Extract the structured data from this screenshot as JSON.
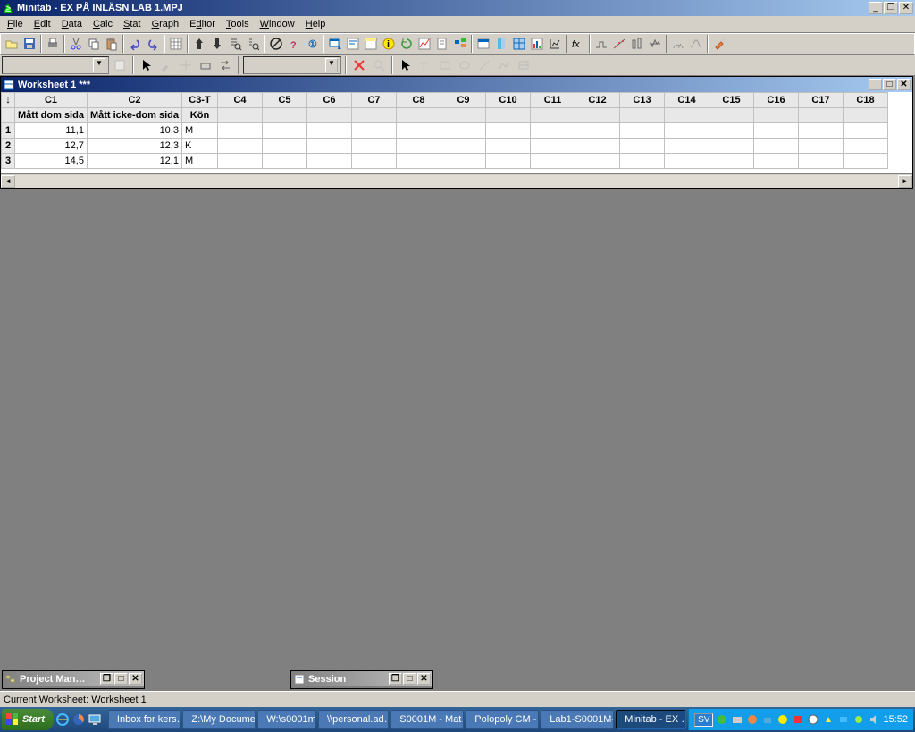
{
  "titlebar": {
    "title": "Minitab - EX PÅ INLÄSN LAB 1.MPJ"
  },
  "menubar": {
    "items": [
      "File",
      "Edit",
      "Data",
      "Calc",
      "Stat",
      "Graph",
      "Editor",
      "Tools",
      "Window",
      "Help"
    ]
  },
  "worksheet": {
    "title": "Worksheet 1 ***",
    "columns": [
      "C1",
      "C2",
      "C3-T",
      "C4",
      "C5",
      "C6",
      "C7",
      "C8",
      "C9",
      "C10",
      "C11",
      "C12",
      "C13",
      "C14",
      "C15",
      "C16",
      "C17",
      "C18"
    ],
    "colnames": [
      "Mått dom sida",
      "Mått icke-dom sida",
      "Kön",
      "",
      "",
      "",
      "",
      "",
      "",
      "",
      "",
      "",
      "",
      "",
      "",
      "",
      "",
      ""
    ],
    "rows": [
      {
        "n": "1",
        "c1": "11,1",
        "c2": "10,3",
        "c3": "M"
      },
      {
        "n": "2",
        "c1": "12,7",
        "c2": "12,3",
        "c3": "K"
      },
      {
        "n": "3",
        "c1": "14,5",
        "c2": "12,1",
        "c3": "M"
      }
    ]
  },
  "minimized": {
    "project": "Project Man…",
    "session": "Session"
  },
  "statusbar": {
    "text": "Current Worksheet: Worksheet 1"
  },
  "taskbar": {
    "start": "Start",
    "tasks": [
      "Inbox for kers…",
      "Z:\\My Docume…",
      "W:\\s0001m",
      "\\\\personal.ad…",
      "S0001M - Mat…",
      "Polopoly CM - …",
      "Lab1-S0001M-…",
      "Minitab - EX …"
    ],
    "lang": "SV",
    "clock": "15:52"
  }
}
